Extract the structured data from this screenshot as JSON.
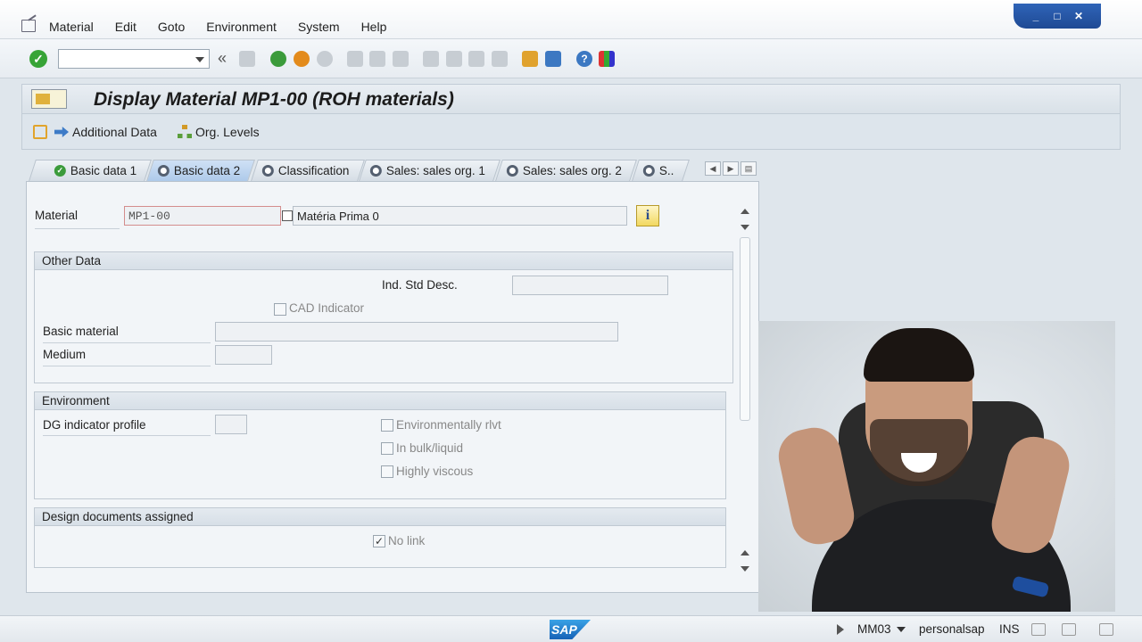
{
  "menu": {
    "items": [
      "Material",
      "Edit",
      "Goto",
      "Environment",
      "System",
      "Help"
    ]
  },
  "window_controls": {
    "minimize": "_",
    "maximize": "□",
    "close": "✕"
  },
  "toolbar": {
    "back_glyph": "«",
    "command_value": "",
    "help_glyph": "?"
  },
  "title": "Display Material MP1-00 (ROH materials)",
  "app_toolbar": {
    "additional_data": "Additional Data",
    "org_levels": "Org. Levels"
  },
  "tabs": [
    {
      "label": "Basic data 1",
      "icon": "check-icon",
      "active": false
    },
    {
      "label": "Basic data 2",
      "icon": "gear-icon",
      "active": true
    },
    {
      "label": "Classification",
      "icon": "gear-icon",
      "active": false
    },
    {
      "label": "Sales: sales org. 1",
      "icon": "gear-icon",
      "active": false
    },
    {
      "label": "Sales: sales org. 2",
      "icon": "gear-icon",
      "active": false
    },
    {
      "label": "S..",
      "icon": "gear-icon",
      "active": false
    }
  ],
  "header": {
    "material_label": "Material",
    "material_value": "MP1-00",
    "description_value": "Matéria Prima 0",
    "info_glyph": "i"
  },
  "other_data": {
    "title": "Other Data",
    "ind_std_desc_label": "Ind. Std Desc.",
    "ind_std_desc_value": "",
    "cad_indicator_label": "CAD Indicator",
    "cad_indicator_checked": false,
    "basic_material_label": "Basic material",
    "basic_material_value": "",
    "medium_label": "Medium",
    "medium_value": ""
  },
  "environment": {
    "title": "Environment",
    "dg_indicator_label": "DG indicator profile",
    "dg_indicator_value": "",
    "env_relevant_label": "Environmentally rlvt",
    "in_bulk_label": "In bulk/liquid",
    "highly_viscous_label": "Highly viscous"
  },
  "design_docs": {
    "title": "Design documents assigned",
    "no_link_label": "No link",
    "no_link_checked": true,
    "check_glyph": "✓"
  },
  "status_bar": {
    "logo": "SAP",
    "transaction": "MM03",
    "system": "personalsap",
    "mode": "INS"
  },
  "colors": {
    "accent": "#2f64b8",
    "tab_active": "#aecaea",
    "ok_green": "#37a437",
    "info_yellow": "#f2d860"
  }
}
